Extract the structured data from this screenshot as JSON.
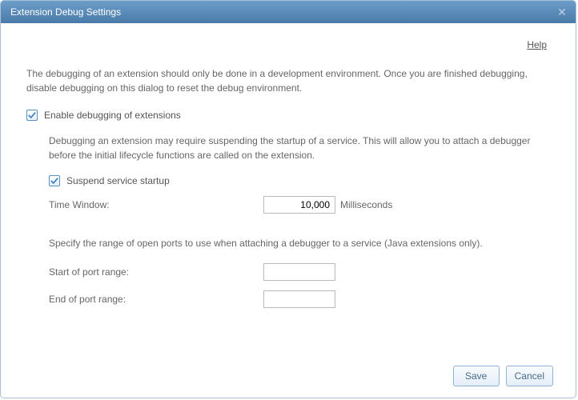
{
  "dialog": {
    "title": "Extension Debug Settings",
    "help_label": "Help"
  },
  "intro": "The debugging of an extension should only be done in a development environment. Once you are finished debugging, disable debugging on this dialog to reset the debug environment.",
  "enable": {
    "label": "Enable debugging of extensions",
    "checked": true
  },
  "suspend": {
    "description": "Debugging an extension may require suspending the startup of a service. This will allow you to attach a debugger before the initial lifecycle functions are called on the extension.",
    "label": "Suspend service startup",
    "checked": true,
    "time_window_label": "Time Window:",
    "time_window_value": "10,000",
    "time_window_unit": "Milliseconds"
  },
  "ports": {
    "description": "Specify the range of open ports to use when attaching a debugger to a service (Java extensions only).",
    "start_label": "Start of port range:",
    "start_value": "",
    "end_label": "End of port range:",
    "end_value": ""
  },
  "buttons": {
    "save": "Save",
    "cancel": "Cancel"
  }
}
